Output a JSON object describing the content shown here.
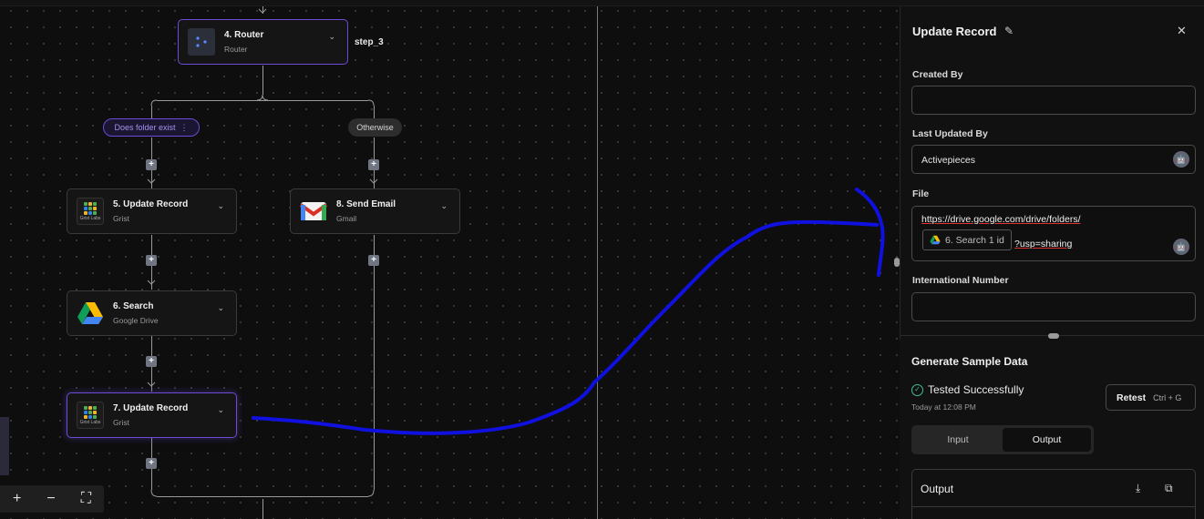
{
  "canvas": {
    "step_label": "step_3",
    "branches": [
      "Does folder exist",
      "Otherwise"
    ],
    "nodes": [
      {
        "title": "4. Router",
        "subtitle": "Router"
      },
      {
        "title": "5. Update Record",
        "subtitle": "Grist"
      },
      {
        "title": "8. Send Email",
        "subtitle": "Gmail"
      },
      {
        "title": "6. Search",
        "subtitle": "Google Drive"
      },
      {
        "title": "7. Update Record",
        "subtitle": "Grist"
      }
    ],
    "grist_icon_text": "Grist Labs",
    "plus": "+",
    "zoom": {
      "in": "+",
      "out": "−",
      "fit": "⛶"
    }
  },
  "panel": {
    "title": "Update Record",
    "edit_icon": "✎",
    "close_icon": "✕",
    "fields": {
      "created_by": {
        "label": "Created By",
        "value": ""
      },
      "last_updated_by": {
        "label": "Last Updated By",
        "value": "Activepieces"
      },
      "file": {
        "label": "File",
        "url_part1": "https://drive.google.com/drive/folders/",
        "chip": "6. Search 1 id",
        "url_part2": "?usp=sharing"
      },
      "international_number": {
        "label": "International Number",
        "value": ""
      }
    }
  },
  "sample": {
    "title": "Generate Sample Data",
    "status": "Tested Successfully",
    "time": "Today at 12:08 PM",
    "retest": "Retest",
    "shortcut": "Ctrl + G",
    "tabs": [
      "Input",
      "Output"
    ],
    "output_label": "Output",
    "download_icon": "⤓",
    "copy_icon": "⧉"
  },
  "colors": {
    "accent": "#6d4bd6",
    "success": "#3fc08f",
    "annotation": "#1010e0"
  }
}
